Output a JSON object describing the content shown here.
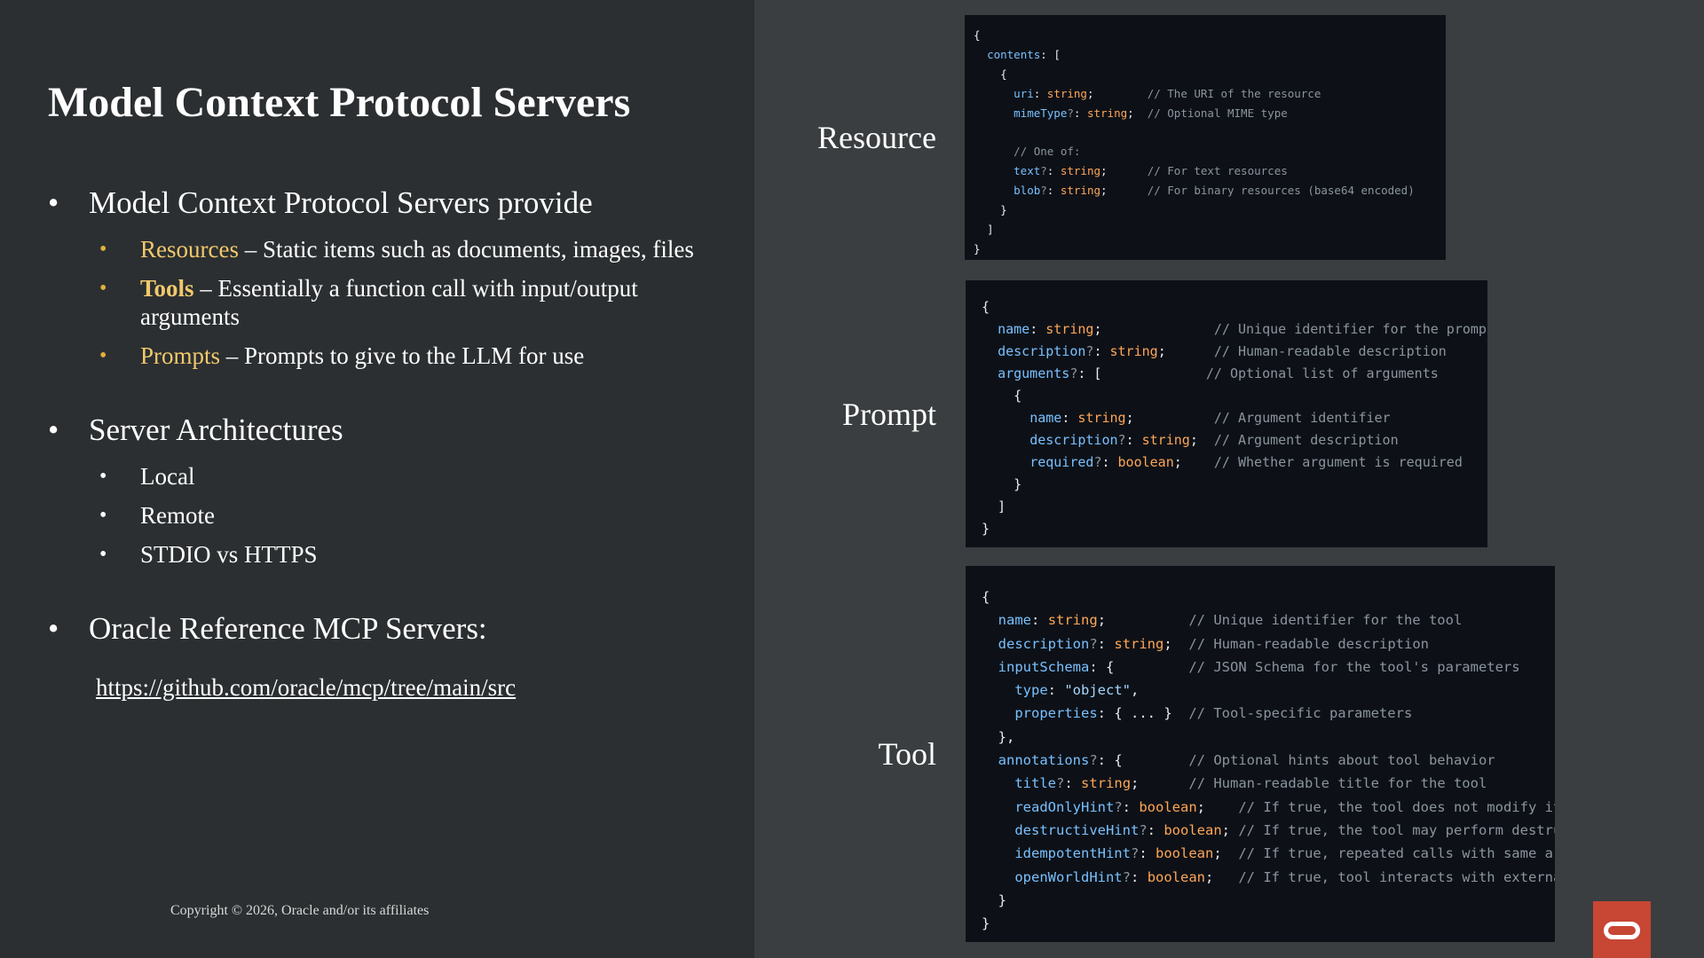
{
  "slide": {
    "title": "Model Context Protocol Servers",
    "bullets": {
      "main1": "Model Context Protocol Servers provide",
      "resources_term": "Resources",
      "resources_desc": " – Static items such as documents, images, files",
      "tools_term": "Tools",
      "tools_desc": " – Essentially a function call with input/output arguments",
      "prompts_term": "Prompts",
      "prompts_desc": " – Prompts to give to the LLM for use",
      "main2": "Server Architectures",
      "arch_local": "Local",
      "arch_remote": "Remote",
      "arch_stdio": "STDIO vs HTTPS",
      "main3": "Oracle Reference MCP Servers:"
    },
    "link": "https://github.com/oracle/mcp/tree/main/src",
    "copyright": "Copyright © 2026, Oracle and/or its affiliates"
  },
  "labels": {
    "resource": "Resource",
    "prompt": "Prompt",
    "tool": "Tool"
  },
  "code": {
    "resource": [
      "{",
      "  contents: [",
      "    {",
      "      uri: string;        // The URI of the resource",
      "      mimeType?: string;  // Optional MIME type",
      "",
      "      // One of:",
      "      text?: string;      // For text resources",
      "      blob?: string;      // For binary resources (base64 encoded)",
      "    }",
      "  ]",
      "}"
    ],
    "prompt": [
      "{",
      "  name: string;              // Unique identifier for the prompt",
      "  description?: string;      // Human-readable description",
      "  arguments?: [             // Optional list of arguments",
      "    {",
      "      name: string;          // Argument identifier",
      "      description?: string;  // Argument description",
      "      required?: boolean;    // Whether argument is required",
      "    }",
      "  ]",
      "}"
    ],
    "tool": [
      "{",
      "  name: string;          // Unique identifier for the tool",
      "  description?: string;  // Human-readable description",
      "  inputSchema: {         // JSON Schema for the tool's parameters",
      "    type: \"object\",",
      "    properties: { ... }  // Tool-specific parameters",
      "  },",
      "  annotations?: {        // Optional hints about tool behavior",
      "    title?: string;      // Human-readable title for the tool",
      "    readOnlyHint?: boolean;    // If true, the tool does not modify its",
      "    destructiveHint?: boolean; // If true, the tool may perform destructive",
      "    idempotentHint?: boolean;  // If true, repeated calls with same args",
      "    openWorldHint?: boolean;   // If true, tool interacts with external",
      "  }",
      "}"
    ]
  },
  "colors": {
    "accent_gold": "#f2c96c",
    "oracle_red": "#c74634",
    "code_bg": "#0d1117"
  },
  "icons": {
    "oracle_logo": "oracle-logo-icon"
  }
}
